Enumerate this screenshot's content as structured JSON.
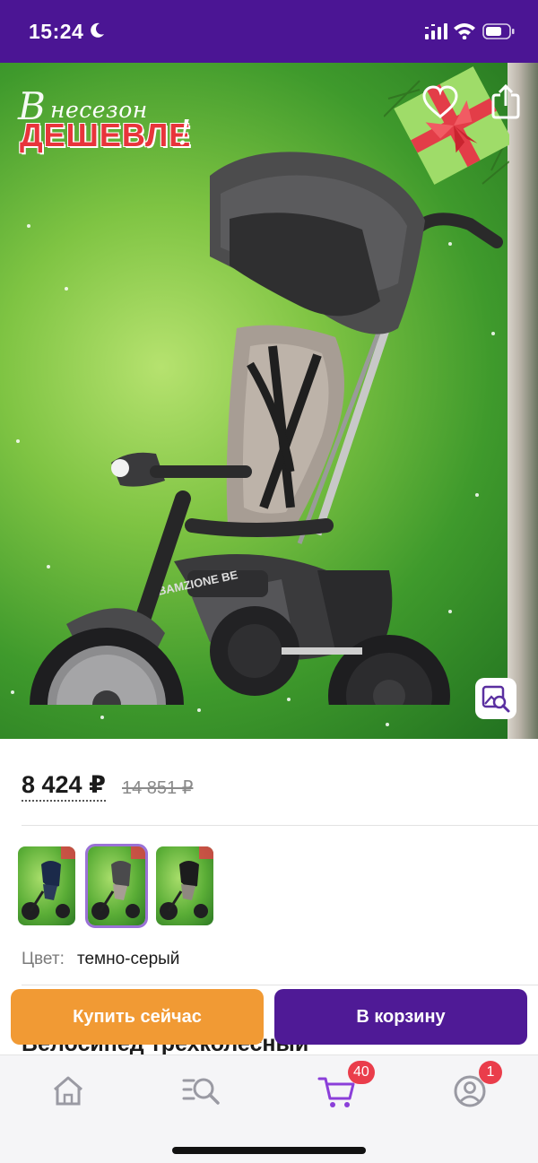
{
  "status_bar": {
    "time": "15:24",
    "icons": [
      "moon-icon",
      "signal-icon",
      "wifi-icon",
      "battery-icon"
    ]
  },
  "hero": {
    "promo_prefix": "В",
    "promo_line1": "несезон",
    "promo_line2": "ДЕШЕВЛЕ",
    "promo_exclaim": "!",
    "product_print": "BAMZIONE BE",
    "icons": [
      "favorite-heart-icon",
      "share-icon",
      "image-search-icon"
    ]
  },
  "price": {
    "current": "8 424 ₽",
    "old": "14 851 ₽"
  },
  "variants": {
    "items": [
      {
        "color": "blue",
        "selected": false
      },
      {
        "color": "dark-gray",
        "selected": true
      },
      {
        "color": "black",
        "selected": false
      }
    ]
  },
  "color": {
    "label": "Цвет:",
    "value": "темно-серый"
  },
  "product": {
    "title": "Велосипед трехколесный"
  },
  "actions": {
    "buy_now": "Купить сейчас",
    "add_to_cart": "В корзину"
  },
  "bottom_nav": {
    "items": [
      {
        "icon": "home-icon",
        "badge": null,
        "active": false
      },
      {
        "icon": "catalog-search-icon",
        "badge": null,
        "active": false
      },
      {
        "icon": "cart-icon",
        "badge": "40",
        "active": true
      },
      {
        "icon": "profile-icon",
        "badge": "1",
        "active": false
      }
    ]
  },
  "colors": {
    "brand_purple": "#4b1594",
    "cart_button": "#4f1a96",
    "buy_now_button": "#f19a34",
    "badge_red": "#ea3d4b",
    "active_nav": "#8b3fd9"
  }
}
